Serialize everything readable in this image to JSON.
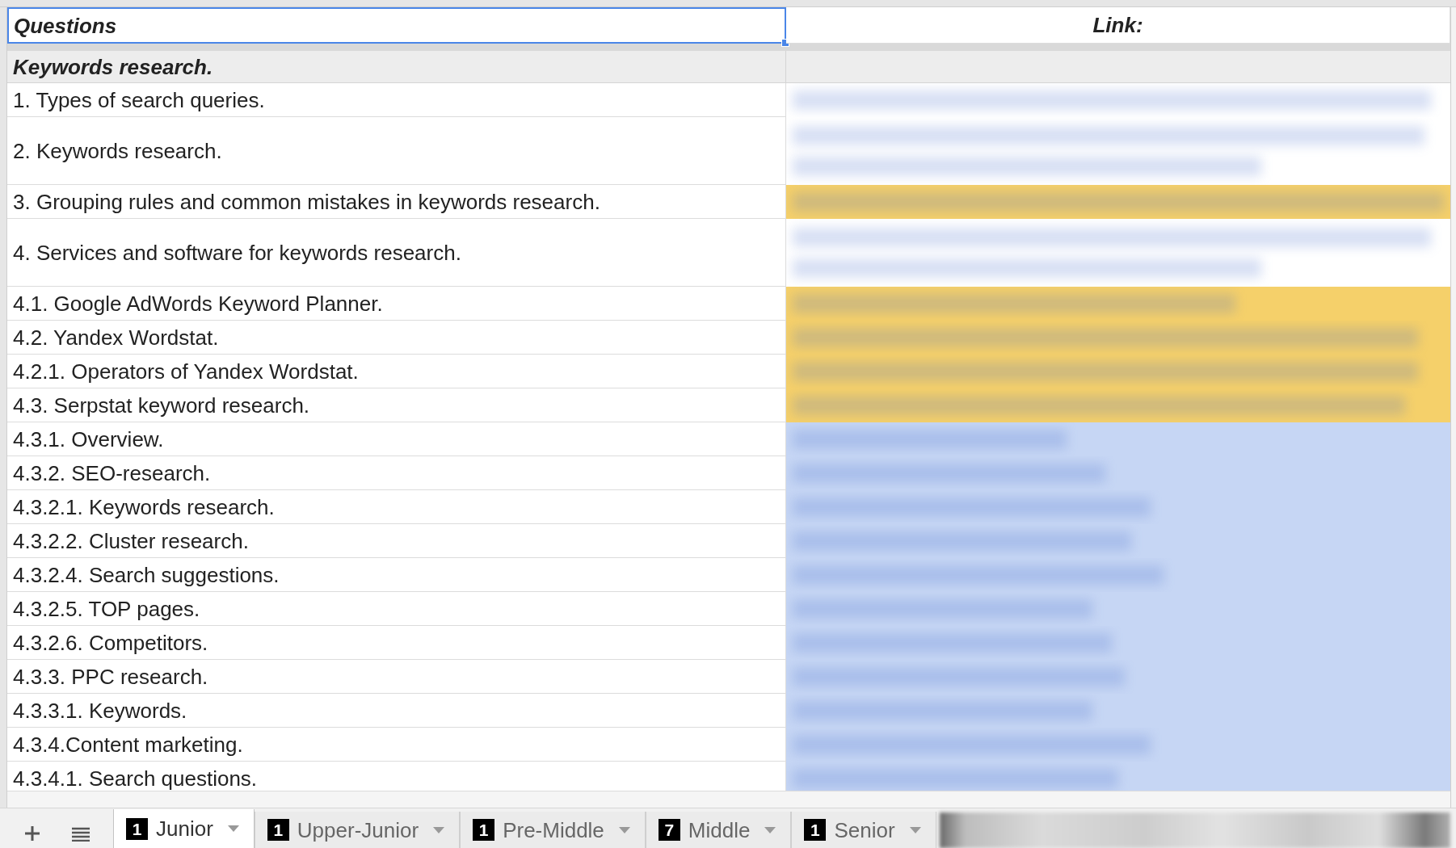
{
  "columns": [
    {
      "label": "Questions",
      "selected": true
    },
    {
      "label": "Link:",
      "selected": false
    }
  ],
  "section": {
    "title": "Keywords research."
  },
  "rows": [
    {
      "question": "1. Types of search queries.",
      "kind": "single",
      "color": "#ffffff"
    },
    {
      "question": "2. Keywords research.",
      "kind": "double",
      "color": "#ffffff"
    },
    {
      "question": "3. Grouping rules and common mistakes in keywords research.",
      "kind": "single",
      "color": "#f5d06a"
    },
    {
      "question": "4. Services and software for keywords research.",
      "kind": "double",
      "color": "#ffffff"
    },
    {
      "question": "4.1. Google AdWords Keyword Planner.",
      "kind": "single",
      "color": "#f5d06a"
    },
    {
      "question": "4.2. Yandex Wordstat.",
      "kind": "single",
      "color": "#f5d06a"
    },
    {
      "question": "4.2.1. Operators of Yandex Wordstat.",
      "kind": "single",
      "color": "#f5d06a"
    },
    {
      "question": "4.3. Serpstat keyword research.",
      "kind": "single",
      "color": "#f5d06a"
    },
    {
      "question": "4.3.1. Overview.",
      "kind": "single",
      "color": "#c6d6f4"
    },
    {
      "question": "4.3.2. SEO-research.",
      "kind": "single",
      "color": "#c6d6f4"
    },
    {
      "question": "4.3.2.1. Keywords research.",
      "kind": "single",
      "color": "#c6d6f4"
    },
    {
      "question": "4.3.2.2. Cluster research.",
      "kind": "single",
      "color": "#c6d6f4"
    },
    {
      "question": "4.3.2.4. Search suggestions.",
      "kind": "single",
      "color": "#c6d6f4"
    },
    {
      "question": "4.3.2.5. TOP pages.",
      "kind": "single",
      "color": "#c6d6f4"
    },
    {
      "question": "4.3.2.6. Competitors.",
      "kind": "single",
      "color": "#c6d6f4"
    },
    {
      "question": "4.3.3. PPC research.",
      "kind": "single",
      "color": "#c6d6f4"
    },
    {
      "question": "4.3.3.1. Keywords.",
      "kind": "single",
      "color": "#c6d6f4"
    },
    {
      "question": "4.3.4.Content marketing.",
      "kind": "single",
      "color": "#c6d6f4"
    },
    {
      "question": "4.3.4.1. Search questions.",
      "kind": "single",
      "color": "#c6d6f4"
    }
  ],
  "sheet_tabs": [
    {
      "count": "1",
      "label": "Junior",
      "selected": true
    },
    {
      "count": "1",
      "label": "Upper-Junior",
      "selected": false
    },
    {
      "count": "1",
      "label": "Pre-Middle",
      "selected": false
    },
    {
      "count": "7",
      "label": "Middle",
      "selected": false
    },
    {
      "count": "1",
      "label": "Senior",
      "selected": false
    }
  ]
}
